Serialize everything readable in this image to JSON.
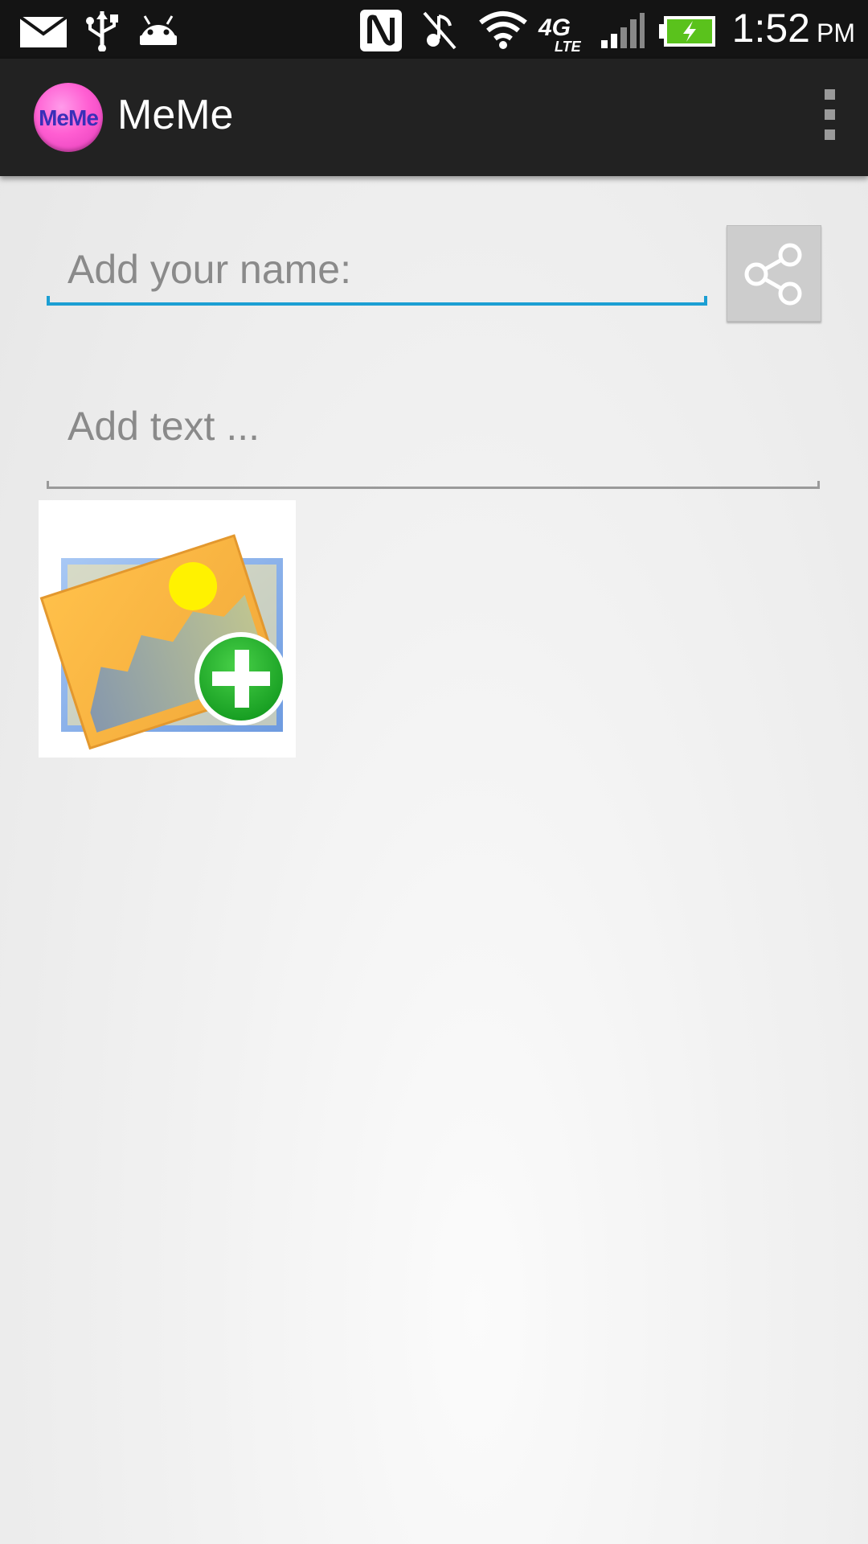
{
  "status_bar": {
    "time": "1:52",
    "am_pm": "PM",
    "network_label": "4G LTE"
  },
  "action_bar": {
    "logo_text": "MeMe",
    "title": "MeMe"
  },
  "form": {
    "name_placeholder": "Add your name:",
    "name_value": "",
    "text_placeholder": "Add text ...",
    "text_value": ""
  },
  "colors": {
    "accent": "#1c9fd3",
    "action_bar": "#222222",
    "status_bar": "#141414",
    "logo_pink": "#ff5ed2"
  }
}
